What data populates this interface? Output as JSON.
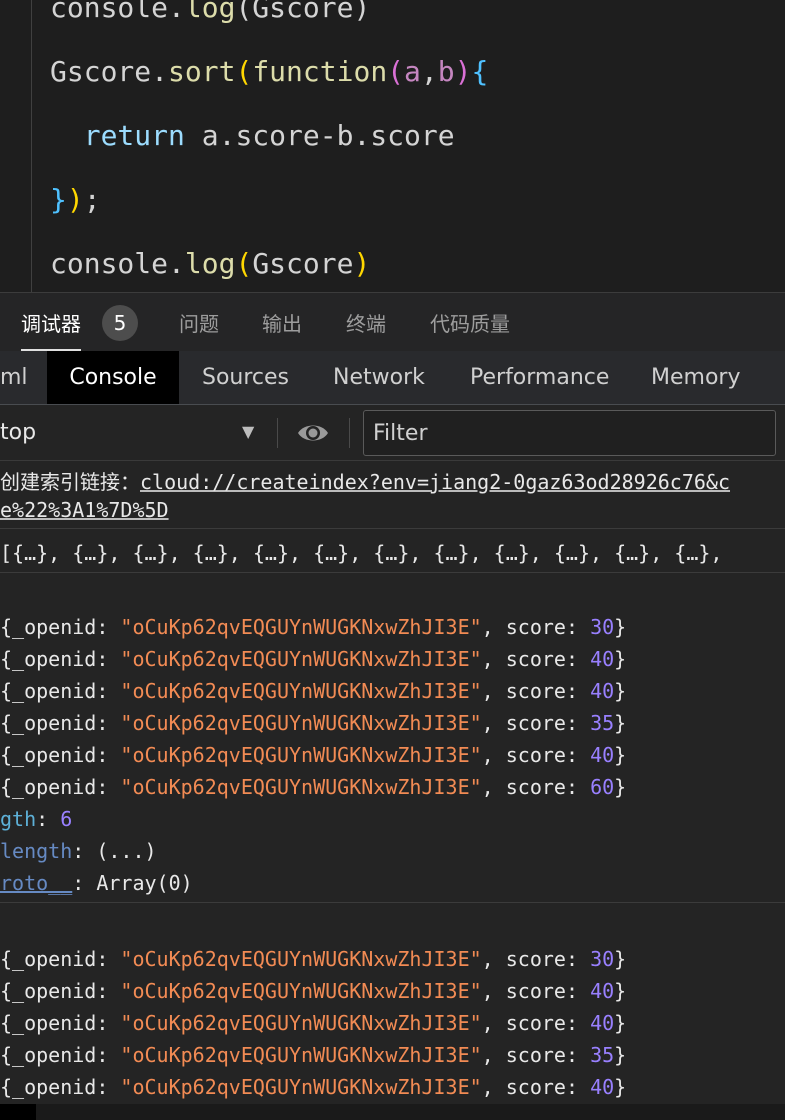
{
  "editor": {
    "lines": [
      [
        {
          "t": "console",
          "c": "tok-id"
        },
        {
          "t": ".",
          "c": "tok-id"
        },
        {
          "t": "log",
          "c": "tok-fn"
        },
        {
          "t": "(Gscore)",
          "c": "tok-id"
        }
      ],
      [
        {
          "t": "Gscore",
          "c": "tok-id"
        },
        {
          "t": ".",
          "c": "tok-id"
        },
        {
          "t": "sort",
          "c": "tok-fn"
        },
        {
          "t": "(",
          "c": "tok-p1"
        },
        {
          "t": "function",
          "c": "tok-fn"
        },
        {
          "t": "(",
          "c": "tok-p2"
        },
        {
          "t": "a",
          "c": "tok-param"
        },
        {
          "t": ",",
          "c": "tok-id"
        },
        {
          "t": "b",
          "c": "tok-param"
        },
        {
          "t": ")",
          "c": "tok-p2"
        },
        {
          "t": "{",
          "c": "tok-brace"
        }
      ],
      [
        {
          "t": "  ",
          "c": "tok-id"
        },
        {
          "t": "return",
          "c": "tok-ret"
        },
        {
          "t": " a.score-b.score",
          "c": "tok-id"
        }
      ],
      [
        {
          "t": "}",
          "c": "tok-brace"
        },
        {
          "t": ")",
          "c": "tok-p1"
        },
        {
          "t": ";",
          "c": "tok-semi"
        }
      ],
      [
        {
          "t": "console",
          "c": "tok-id"
        },
        {
          "t": ".",
          "c": "tok-id"
        },
        {
          "t": "log",
          "c": "tok-fn"
        },
        {
          "t": "(",
          "c": "tok-p1"
        },
        {
          "t": "Gscore",
          "c": "tok-id"
        },
        {
          "t": ")",
          "c": "tok-p1"
        }
      ]
    ]
  },
  "panel_tabs": {
    "debugger": "调试器",
    "badge": "5",
    "problems": "问题",
    "output": "输出",
    "terminal": "终端",
    "code_quality": "代码质量"
  },
  "devtools_tabs": {
    "html": "ml",
    "console": "Console",
    "sources": "Sources",
    "network": "Network",
    "performance": "Performance",
    "memory": "Memory"
  },
  "toolbar": {
    "context": "top",
    "context_arrow": "▼",
    "filter_placeholder": "Filter",
    "eye_icon": "eye-icon"
  },
  "console": {
    "index_msg_label": "创建索引链接：",
    "index_link_line1": "cloud://createindex?env=jiang2-0gaz63od28926c76&c",
    "index_link_line2": "e%22%3A1%7D%5D",
    "array_summary": "[{…}, {…}, {…}, {…}, {…}, {…}, {…}, {…}, {…}, {…}, {…}, {…},",
    "group1": {
      "items": [
        {
          "key": "{_openid",
          "value": "\"oCuKp62qvEQGUYnWUGKNxwZhJI3E\"",
          "score": "30"
        },
        {
          "key": "{_openid",
          "value": "\"oCuKp62qvEQGUYnWUGKNxwZhJI3E\"",
          "score": "40"
        },
        {
          "key": "{_openid",
          "value": "\"oCuKp62qvEQGUYnWUGKNxwZhJI3E\"",
          "score": "40"
        },
        {
          "key": "{_openid",
          "value": "\"oCuKp62qvEQGUYnWUGKNxwZhJI3E\"",
          "score": "35"
        },
        {
          "key": "{_openid",
          "value": "\"oCuKp62qvEQGUYnWUGKNxwZhJI3E\"",
          "score": "40"
        },
        {
          "key": "{_openid",
          "value": "\"oCuKp62qvEQGUYnWUGKNxwZhJI3E\"",
          "score": "60"
        }
      ],
      "length_key": "gth",
      "length_val": "6",
      "getter_key": "length",
      "getter_val": "(...)",
      "proto_key": "roto__",
      "proto_val": "Array(0)"
    },
    "group2": {
      "items": [
        {
          "key": "{_openid",
          "value": "\"oCuKp62qvEQGUYnWUGKNxwZhJI3E\"",
          "score": "30"
        },
        {
          "key": "{_openid",
          "value": "\"oCuKp62qvEQGUYnWUGKNxwZhJI3E\"",
          "score": "40"
        },
        {
          "key": "{_openid",
          "value": "\"oCuKp62qvEQGUYnWUGKNxwZhJI3E\"",
          "score": "40"
        },
        {
          "key": "{_openid",
          "value": "\"oCuKp62qvEQGUYnWUGKNxwZhJI3E\"",
          "score": "35"
        },
        {
          "key": "{_openid",
          "value": "\"oCuKp62qvEQGUYnWUGKNxwZhJI3E\"",
          "score": "40"
        }
      ]
    },
    "score_key": "score",
    "colors": {
      "string": "#f28b54",
      "number": "#9980ff",
      "dim_key": "#5db0d7"
    }
  }
}
